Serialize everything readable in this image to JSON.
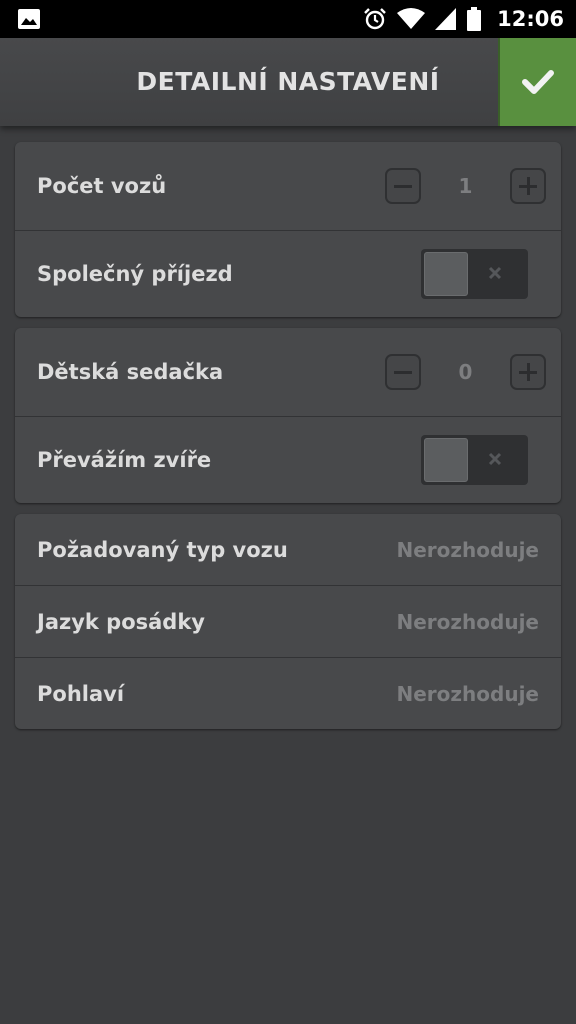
{
  "status_bar": {
    "time": "12:06",
    "icons": [
      "image-icon",
      "alarm-icon",
      "wifi-icon",
      "signal-icon",
      "battery-icon"
    ]
  },
  "header": {
    "title": "DETAILNÍ NASTAVENÍ",
    "confirm_icon": "checkmark-icon",
    "confirm_color": "#59903f"
  },
  "group1": {
    "car_count": {
      "label": "Počet vozů",
      "value": "1"
    },
    "shared_arrival": {
      "label": "Společný příjezd",
      "enabled": false
    }
  },
  "group2": {
    "child_seat": {
      "label": "Dětská sedačka",
      "value": "0"
    },
    "animal": {
      "label": "Převážím zvíře",
      "enabled": false
    }
  },
  "group3": {
    "car_type": {
      "label": "Požadovaný typ vozu",
      "value": "Nerozhoduje"
    },
    "crew_language": {
      "label": "Jazyk posádky",
      "value": "Nerozhoduje"
    },
    "gender": {
      "label": "Pohlaví",
      "value": "Nerozhoduje"
    }
  }
}
